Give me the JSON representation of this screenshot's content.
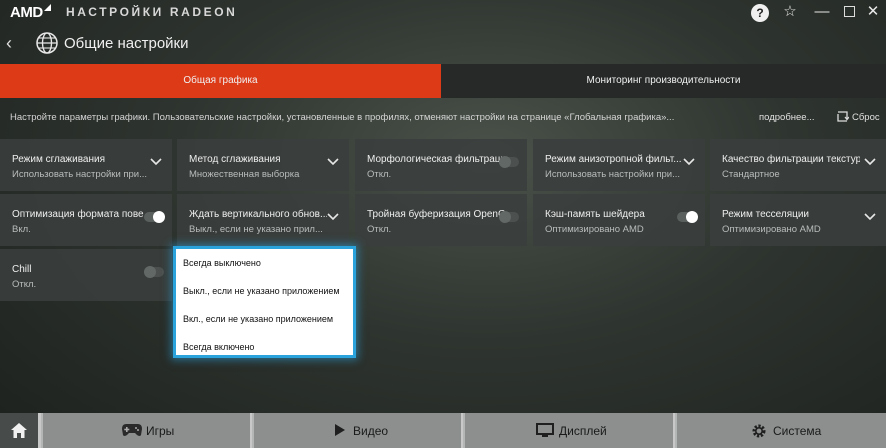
{
  "window": {
    "brand": "AMD",
    "title": "НАСТРОЙКИ RADEON",
    "help_glyph": "?",
    "favorite_glyph": "☆",
    "minimize_glyph": "—",
    "close_glyph": "✕"
  },
  "header": {
    "back_glyph": "‹",
    "page_title": "Общие настройки"
  },
  "tabs": [
    {
      "label": "Общая графика",
      "active": true
    },
    {
      "label": "Мониторинг производительности",
      "active": false
    }
  ],
  "info": {
    "text": "Настройте параметры графики. Пользовательские настройки, установленные в профилях, отменяют настройки на странице «Глобальная графика»...",
    "more_link": "подробнее...",
    "reset_label": "Сброс"
  },
  "tiles": [
    {
      "title": "Режим сглаживания",
      "value": "Использовать настройки при...",
      "control": "chevron"
    },
    {
      "title": "Метод сглаживания",
      "value": "Множественная выборка",
      "control": "chevron"
    },
    {
      "title": "Морфологическая фильтрация",
      "value": "Откл.",
      "control": "toggle-off"
    },
    {
      "title": "Режим анизотропной фильт...",
      "value": "Использовать настройки при...",
      "control": "chevron"
    },
    {
      "title": "Качество фильтрации текстур",
      "value": "Стандартное",
      "control": "chevron"
    },
    {
      "title": "Оптимизация формата пове...",
      "value": "Вкл.",
      "control": "toggle-on"
    },
    {
      "title": "Ждать вертикального обнов...",
      "value": "Выкл., если не указано прил...",
      "control": "chevron"
    },
    {
      "title": "Тройная буферизация OpenGL",
      "value": "Откл.",
      "control": "toggle-off"
    },
    {
      "title": "Кэш-память шейдера",
      "value": "Оптимизировано AMD",
      "control": "toggle-on"
    },
    {
      "title": "Режим тесселяции",
      "value": "Оптимизировано AMD",
      "control": "chevron"
    },
    {
      "title": "Chill",
      "value": "Откл.",
      "control": "toggle-off"
    }
  ],
  "dropdown": {
    "options": [
      "Всегда выключено",
      "Выкл., если не указано приложением",
      "Вкл., если не указано приложением",
      "Всегда включено"
    ]
  },
  "bottom_nav": [
    {
      "label": "Игры",
      "icon": "gamepad-icon"
    },
    {
      "label": "Видео",
      "icon": "play-icon"
    },
    {
      "label": "Дисплей",
      "icon": "monitor-icon"
    },
    {
      "label": "Система",
      "icon": "gear-icon"
    }
  ],
  "colors": {
    "accent": "#dd3a18",
    "dropdown_border": "#2aa3dc"
  }
}
